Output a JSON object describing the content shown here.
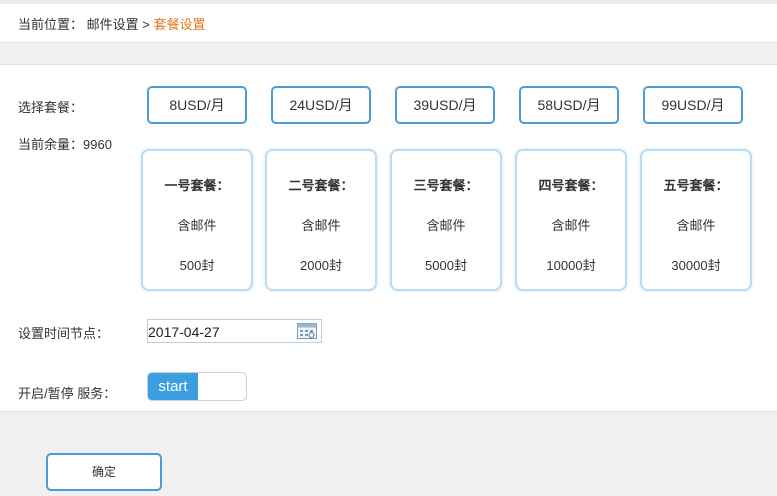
{
  "breadcrumb": {
    "prefix": "当前位置：",
    "parent": "邮件设置",
    "separator": ">",
    "current": "套餐设置"
  },
  "labels": {
    "select_plan": "选择套餐：",
    "balance": "当前余量：9960",
    "time_node": "设置时间节点：",
    "service_toggle": "开启/暂停 服务："
  },
  "plans": [
    {
      "price": "8USD/月",
      "name": "一号套餐：",
      "mail": "含邮件",
      "count": "500封"
    },
    {
      "price": "24USD/月",
      "name": "二号套餐：",
      "mail": "含邮件",
      "count": "2000封"
    },
    {
      "price": "39USD/月",
      "name": "三号套餐：",
      "mail": "含邮件",
      "count": "5000封"
    },
    {
      "price": "58USD/月",
      "name": "四号套餐：",
      "mail": "含邮件",
      "count": "10000封"
    },
    {
      "price": "99USD/月",
      "name": "五号套餐：",
      "mail": "含邮件",
      "count": "30000封"
    }
  ],
  "date": {
    "value": "2017-04-27",
    "icon": "calendar-icon"
  },
  "toggle": {
    "on_label": "start",
    "state": "on"
  },
  "confirm_label": "确定",
  "colors": {
    "accent": "#4e9cd6",
    "toggle_on": "#3a9ee0",
    "breadcrumb_current": "#e07a1f",
    "card_border": "#b9dcf5"
  }
}
